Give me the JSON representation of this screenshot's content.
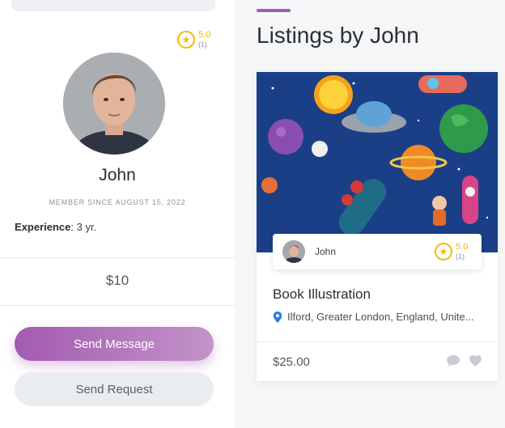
{
  "profile": {
    "rating": {
      "score": "5.0",
      "count": "(1)"
    },
    "name": "John",
    "member_since": "MEMBER SINCE AUGUST 15, 2022",
    "experience_label": "Experience",
    "experience_value": ": 3 yr.",
    "price": "$10",
    "send_message_label": "Send Message",
    "send_request_label": "Send Request"
  },
  "listings": {
    "heading": "Listings by John",
    "items": [
      {
        "seller_name": "John",
        "rating": {
          "score": "5.0",
          "count": "(1)"
        },
        "title": "Book Illustration",
        "location": "Ilford, Greater London, England, Unite...",
        "price": "$25.00"
      }
    ]
  },
  "colors": {
    "accent": "#a35bb0",
    "star": "#f5b800",
    "pin": "#2a7de1"
  },
  "icons": {
    "rating": "star-circle-icon",
    "location": "map-pin-icon",
    "chat": "chat-bubble-icon",
    "favorite": "heart-icon"
  }
}
